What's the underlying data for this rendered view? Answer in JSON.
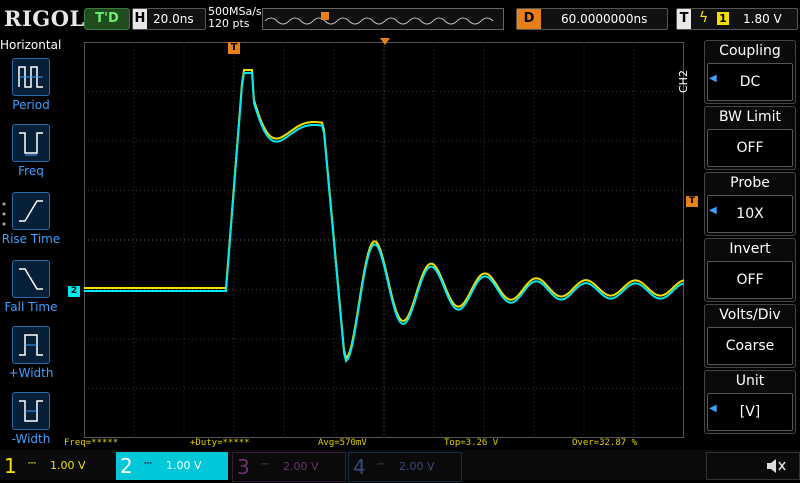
{
  "top": {
    "brand": "RIGOL",
    "run_status": "T'D",
    "horizontal_key": "H",
    "timebase": "20.0ns",
    "sample_rate": "500MSa/s",
    "points": "120 pts",
    "delay_key": "D",
    "delay": "60.0000000ns",
    "trigger_key": "T",
    "trigger_source": "1",
    "trigger_level": "1.80 V"
  },
  "left_menu": {
    "title": "Horizontal",
    "items": [
      {
        "label": "Period",
        "icon": "period-icon"
      },
      {
        "label": "Freq",
        "icon": "frequency-icon"
      },
      {
        "label": "Rise Time",
        "icon": "rise-time-icon"
      },
      {
        "label": "Fall Time",
        "icon": "fall-time-icon"
      },
      {
        "label": "+Width",
        "icon": "positive-width-icon"
      },
      {
        "label": "-Width",
        "icon": "negative-width-icon"
      }
    ]
  },
  "measurements": {
    "freq": "Freq=*****",
    "duty": "+Duty=*****",
    "avg": "Avg=570mV",
    "top": "Top=3.26 V",
    "over": "Over=32.87 %"
  },
  "markers": {
    "trigger_marker": "T",
    "ch2_marker": "2",
    "trigger_level_marker": "T"
  },
  "right_menu": {
    "channel_tag": "CH2",
    "items": [
      {
        "title": "Coupling",
        "value": "DC"
      },
      {
        "title": "BW Limit",
        "value": "OFF"
      },
      {
        "title": "Probe",
        "value": "10X"
      },
      {
        "title": "Invert",
        "value": "OFF"
      },
      {
        "title": "Volts/Div",
        "value": "Coarse"
      },
      {
        "title": "Unit",
        "value": "[V]"
      }
    ]
  },
  "channels": [
    {
      "num": "1",
      "scale": "1.00 V",
      "color": "#f3e000"
    },
    {
      "num": "2",
      "scale": "1.00 V",
      "color": "#00e8f0"
    },
    {
      "num": "3",
      "scale": "2.00 V",
      "color": "#c020c0"
    },
    {
      "num": "4",
      "scale": "2.00 V",
      "color": "#4a6aff"
    }
  ],
  "speaker_icon": "speaker-mute-icon"
}
